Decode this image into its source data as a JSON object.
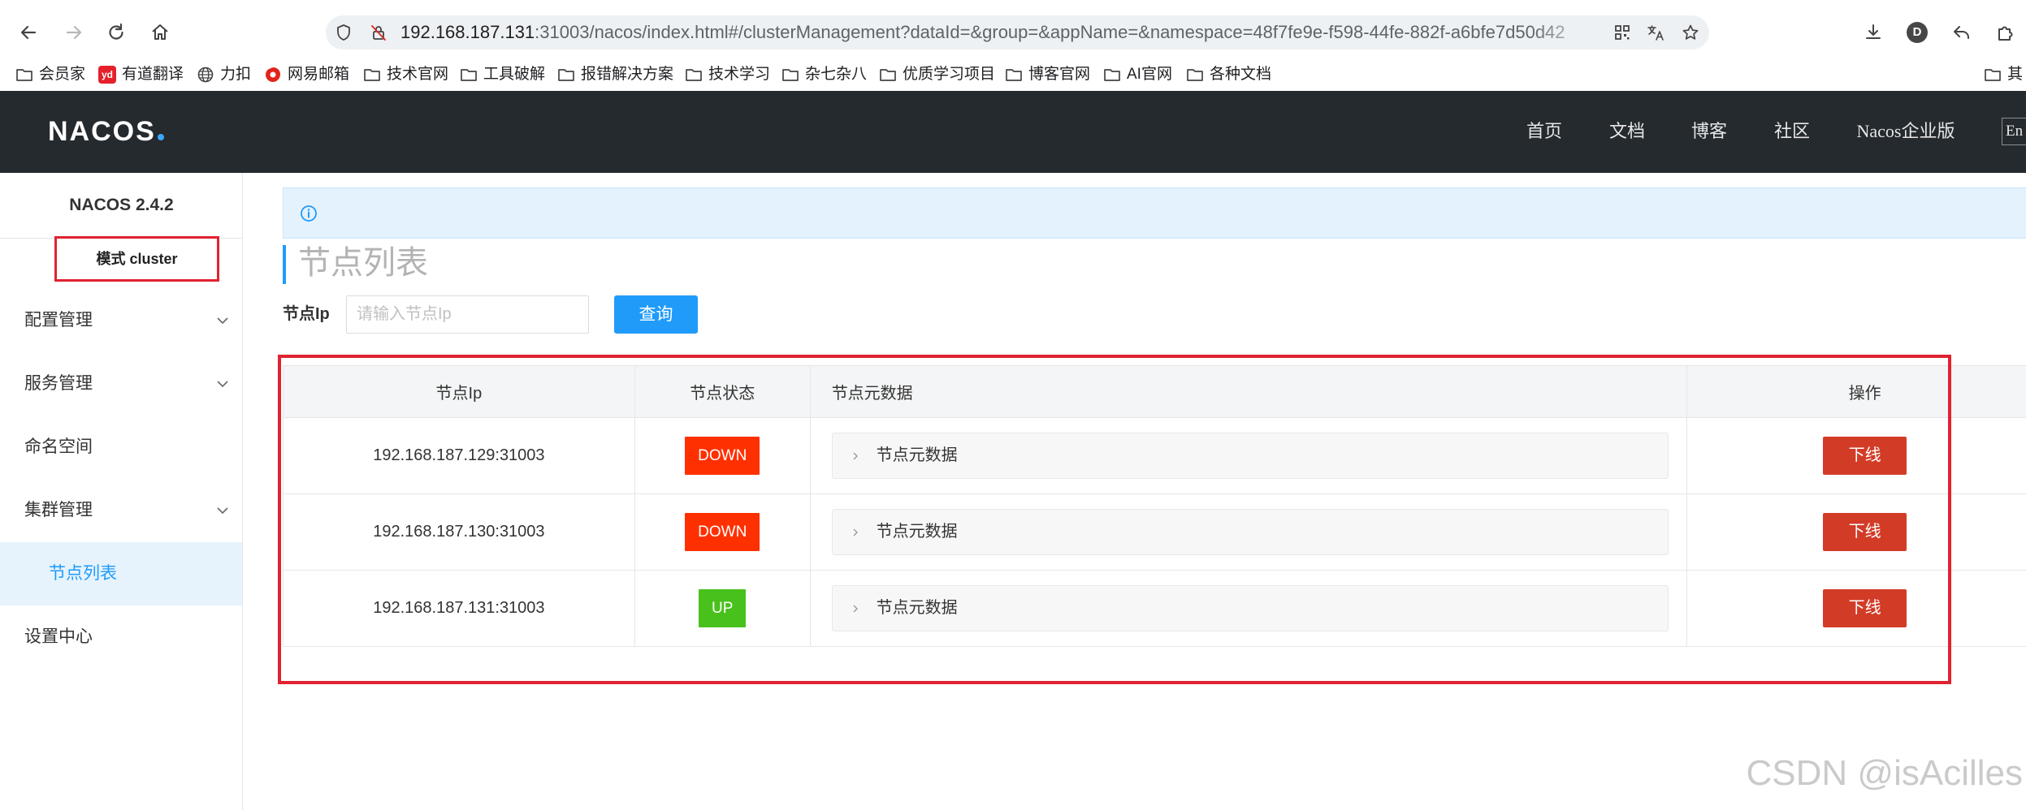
{
  "browser": {
    "url_host": "192.168.187.131",
    "url_path": ":31003/nacos/index.html#/clusterManagement?dataId=&group=&appName=&namespace=48f7fe9e-f598-44fe-882f-a6bfe7d50d42",
    "profile_initial": "D",
    "bookmarks": [
      {
        "label": "会员家",
        "icon": "folder-icon"
      },
      {
        "label": "有道翻译",
        "icon": "youdao-icon",
        "badge": "yd"
      },
      {
        "label": "力扣",
        "icon": "globe-icon"
      },
      {
        "label": "网易邮箱",
        "icon": "netease-mail-icon"
      },
      {
        "label": "技术官网",
        "icon": "folder-icon"
      },
      {
        "label": "工具破解",
        "icon": "folder-icon"
      },
      {
        "label": "报错解决方案",
        "icon": "folder-icon"
      },
      {
        "label": "技术学习",
        "icon": "folder-icon"
      },
      {
        "label": "杂七杂八",
        "icon": "folder-icon"
      },
      {
        "label": "优质学习项目",
        "icon": "folder-icon"
      },
      {
        "label": "博客官网",
        "icon": "folder-icon"
      },
      {
        "label": "AI官网",
        "icon": "folder-icon"
      },
      {
        "label": "各种文档",
        "icon": "folder-icon"
      },
      {
        "label": "其",
        "icon": "folder-icon"
      }
    ]
  },
  "header": {
    "logo": "NACOS",
    "nav": [
      "首页",
      "文档",
      "博客",
      "社区",
      "Nacos企业版"
    ],
    "language": "En"
  },
  "sidebar": {
    "version": "NACOS 2.4.2",
    "mode": "模式 cluster",
    "menu": [
      {
        "label": "配置管理",
        "expandable": true
      },
      {
        "label": "服务管理",
        "expandable": true
      },
      {
        "label": "命名空间",
        "expandable": false
      },
      {
        "label": "集群管理",
        "expandable": true
      },
      {
        "label": "节点列表",
        "expandable": false,
        "active": true
      },
      {
        "label": "设置中心",
        "expandable": false
      }
    ]
  },
  "main": {
    "title": "节点列表",
    "search": {
      "label": "节点Ip",
      "placeholder": "请输入节点Ip",
      "value": "",
      "button": "查询"
    },
    "table": {
      "columns": [
        "节点Ip",
        "节点状态",
        "节点元数据",
        "操作"
      ],
      "rows": [
        {
          "ip": "192.168.187.129:31003",
          "status": "DOWN",
          "metadata": "节点元数据",
          "action": "下线"
        },
        {
          "ip": "192.168.187.130:31003",
          "status": "DOWN",
          "metadata": "节点元数据",
          "action": "下线"
        },
        {
          "ip": "192.168.187.131:31003",
          "status": "UP",
          "metadata": "节点元数据",
          "action": "下线"
        }
      ]
    }
  },
  "watermark": "CSDN @isAcilles",
  "colors": {
    "primary": "#209bfa",
    "header_bg": "#252a2f",
    "offline_button": "#d23c27",
    "annotation": "#e02330",
    "status": {
      "DOWN": "#ff3000",
      "UP": "#49c11c"
    }
  }
}
